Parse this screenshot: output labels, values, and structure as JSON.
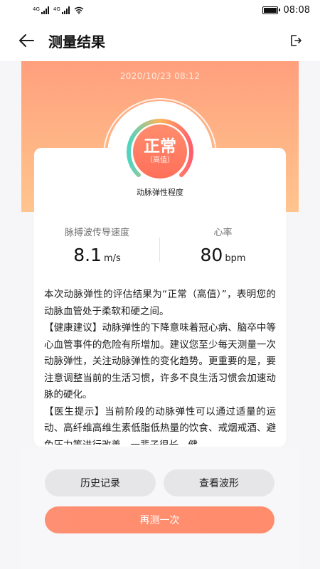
{
  "status_bar": {
    "signal1_label": "4G",
    "signal2_label": "4G",
    "time": "08:08"
  },
  "header": {
    "title": "测量结果"
  },
  "result": {
    "timestamp": "2020/10/23 08:12",
    "status": "正常",
    "status_detail": "（高值）",
    "caption": "动脉弹性程度"
  },
  "metrics": [
    {
      "label": "脉搏波传导速度",
      "value": "8.1",
      "unit": "m/s"
    },
    {
      "label": "心率",
      "value": "80",
      "unit": "bpm"
    }
  ],
  "report": {
    "paragraphs": [
      "本次动脉弹性的评估结果为“正常（高值）”，表明您的动脉血管处于柔软和硬之间。",
      "【健康建议】动脉弹性的下降意味着冠心病、脑卒中等心血管事件的危险有所增加。建议您至少每天测量一次动脉弹性，关注动脉弹性的变化趋势。更重要的是，要注意调整当前的生活习惯，许多不良生活习惯会加速动脉的硬化。",
      "【医生提示】当前阶段的动脉弹性可以通过适量的运动、高纤维高维生素低脂低热量的饮食、戒烟戒酒、避免压力等进行改善。一辈子很长，健"
    ]
  },
  "buttons": {
    "history": "历史记录",
    "waveform": "查看波形",
    "again": "再测一次"
  },
  "colors": {
    "accent": "#ff8c6b",
    "gauge_teal": "#4fd4c0",
    "gauge_red": "#ff5f6d",
    "hero_top": "#ff9f7d",
    "hero_bottom": "#ffc58f"
  }
}
